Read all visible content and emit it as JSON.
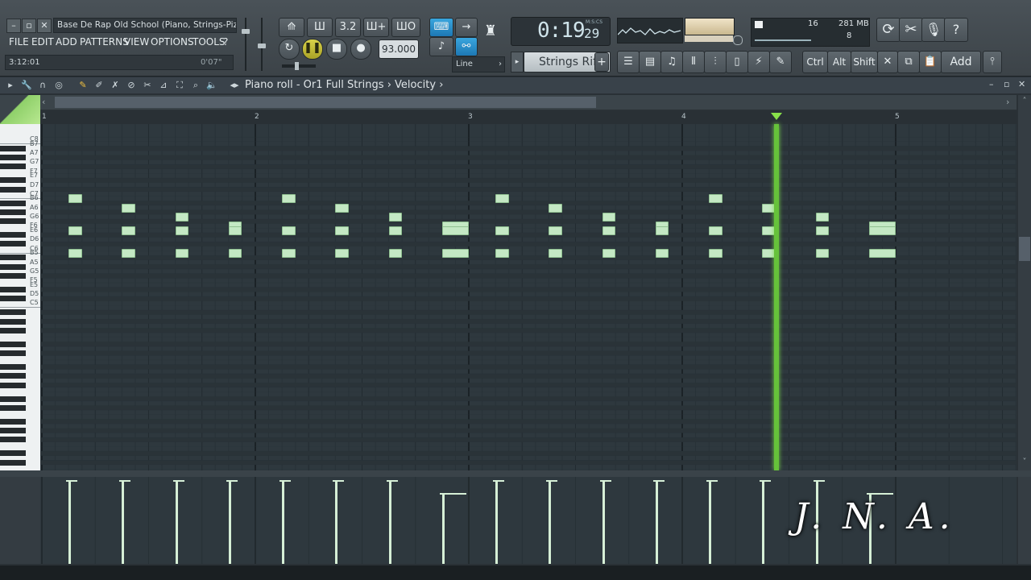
{
  "window": {
    "title": "Base De Rap Old School (Piano, Strings-Piz...",
    "hint_left": "3:12:01",
    "hint_right": "0'07\""
  },
  "menu": [
    "FILE",
    "EDIT",
    "ADD",
    "PATTERNS",
    "VIEW",
    "OPTIONS",
    "TOOLS",
    "?"
  ],
  "transport": {
    "tempo": "93.000",
    "snap_mode": "Line",
    "time_main": "0:19",
    "time_sub": "29",
    "time_unit": "M:S:CS",
    "pattern": "Strings Riff",
    "pattern_add": "+"
  },
  "stats": {
    "cpu": "16",
    "memory": "281 MB",
    "polyphony": "8"
  },
  "shortcuts": {
    "ctrl": "Ctrl",
    "alt": "Alt",
    "shift": "Shift",
    "add": "Add"
  },
  "toolbar_icons": [
    "metronome-icon",
    "waveform-icon",
    "pattern-song-icon",
    "step-icon",
    "loop-icon"
  ],
  "piano_roll": {
    "title": "Piano roll - Or1 Full Strings",
    "sep": "›",
    "target": "Velocity",
    "target_arrow": "›"
  },
  "bars": [
    "1",
    "2",
    "3",
    "4",
    "5"
  ],
  "keys": [
    "C8",
    "B7",
    "A7",
    "G7",
    "F7",
    "E7",
    "D7",
    "C7",
    "B6",
    "A6",
    "G6",
    "F6",
    "E6",
    "D6",
    "C6",
    "B5",
    "A5",
    "G5",
    "F5",
    "E5",
    "D5",
    "C5"
  ],
  "watermark": "J. N. A.",
  "colors": {
    "note": "#c4e8c4",
    "playhead": "#66c23a",
    "accent_blue": "#2a90cc"
  },
  "playhead_bar": 4.44,
  "notes": [
    {
      "pitch": "B6",
      "start": 1.125,
      "len": 0.0625
    },
    {
      "pitch": "E6",
      "start": 1.125,
      "len": 0.0625
    },
    {
      "pitch": "B5",
      "start": 1.125,
      "len": 0.0625
    },
    {
      "pitch": "A6",
      "start": 1.375,
      "len": 0.0625
    },
    {
      "pitch": "E6",
      "start": 1.375,
      "len": 0.0625
    },
    {
      "pitch": "B5",
      "start": 1.375,
      "len": 0.0625
    },
    {
      "pitch": "G6",
      "start": 1.625,
      "len": 0.0625
    },
    {
      "pitch": "E6",
      "start": 1.625,
      "len": 0.0625
    },
    {
      "pitch": "B5",
      "start": 1.625,
      "len": 0.0625
    },
    {
      "pitch": "F6",
      "start": 1.875,
      "len": 0.0625
    },
    {
      "pitch": "E6",
      "start": 1.875,
      "len": 0.0625
    },
    {
      "pitch": "B5",
      "start": 1.875,
      "len": 0.0625
    },
    {
      "pitch": "B6",
      "start": 2.125,
      "len": 0.0625
    },
    {
      "pitch": "E6",
      "start": 2.125,
      "len": 0.0625
    },
    {
      "pitch": "B5",
      "start": 2.125,
      "len": 0.0625
    },
    {
      "pitch": "A6",
      "start": 2.375,
      "len": 0.0625
    },
    {
      "pitch": "E6",
      "start": 2.375,
      "len": 0.0625
    },
    {
      "pitch": "B5",
      "start": 2.375,
      "len": 0.0625
    },
    {
      "pitch": "G6",
      "start": 2.625,
      "len": 0.0625
    },
    {
      "pitch": "E6",
      "start": 2.625,
      "len": 0.0625
    },
    {
      "pitch": "B5",
      "start": 2.625,
      "len": 0.0625
    },
    {
      "pitch": "F6",
      "start": 2.875,
      "len": 0.125
    },
    {
      "pitch": "E6",
      "start": 2.875,
      "len": 0.125
    },
    {
      "pitch": "B5",
      "start": 2.875,
      "len": 0.125
    },
    {
      "pitch": "B6",
      "start": 3.125,
      "len": 0.0625
    },
    {
      "pitch": "E6",
      "start": 3.125,
      "len": 0.0625
    },
    {
      "pitch": "B5",
      "start": 3.125,
      "len": 0.0625
    },
    {
      "pitch": "A6",
      "start": 3.375,
      "len": 0.0625
    },
    {
      "pitch": "E6",
      "start": 3.375,
      "len": 0.0625
    },
    {
      "pitch": "B5",
      "start": 3.375,
      "len": 0.0625
    },
    {
      "pitch": "G6",
      "start": 3.625,
      "len": 0.0625
    },
    {
      "pitch": "E6",
      "start": 3.625,
      "len": 0.0625
    },
    {
      "pitch": "B5",
      "start": 3.625,
      "len": 0.0625
    },
    {
      "pitch": "F6",
      "start": 3.875,
      "len": 0.0625
    },
    {
      "pitch": "E6",
      "start": 3.875,
      "len": 0.0625
    },
    {
      "pitch": "B5",
      "start": 3.875,
      "len": 0.0625
    },
    {
      "pitch": "B6",
      "start": 4.125,
      "len": 0.0625
    },
    {
      "pitch": "E6",
      "start": 4.125,
      "len": 0.0625
    },
    {
      "pitch": "B5",
      "start": 4.125,
      "len": 0.0625
    },
    {
      "pitch": "A6",
      "start": 4.375,
      "len": 0.0625
    },
    {
      "pitch": "E6",
      "start": 4.375,
      "len": 0.0625
    },
    {
      "pitch": "B5",
      "start": 4.375,
      "len": 0.0625
    },
    {
      "pitch": "G6",
      "start": 4.625,
      "len": 0.0625
    },
    {
      "pitch": "E6",
      "start": 4.625,
      "len": 0.0625
    },
    {
      "pitch": "B5",
      "start": 4.625,
      "len": 0.0625
    },
    {
      "pitch": "F6",
      "start": 4.875,
      "len": 0.125
    },
    {
      "pitch": "E6",
      "start": 4.875,
      "len": 0.125
    },
    {
      "pitch": "B5",
      "start": 4.875,
      "len": 0.125
    }
  ],
  "velocities": [
    {
      "start": 1.125,
      "level": 1.0
    },
    {
      "start": 1.375,
      "level": 1.0
    },
    {
      "start": 1.625,
      "level": 1.0
    },
    {
      "start": 1.875,
      "level": 1.0
    },
    {
      "start": 2.125,
      "level": 1.0
    },
    {
      "start": 2.375,
      "level": 1.0
    },
    {
      "start": 2.625,
      "level": 1.0
    },
    {
      "start": 2.875,
      "level": 0.85,
      "len": 0.125
    },
    {
      "start": 3.125,
      "level": 1.0
    },
    {
      "start": 3.375,
      "level": 1.0
    },
    {
      "start": 3.625,
      "level": 1.0
    },
    {
      "start": 3.875,
      "level": 1.0
    },
    {
      "start": 4.125,
      "level": 1.0
    },
    {
      "start": 4.375,
      "level": 1.0
    },
    {
      "start": 4.625,
      "level": 1.0
    },
    {
      "start": 4.875,
      "level": 0.85,
      "len": 0.125
    }
  ]
}
